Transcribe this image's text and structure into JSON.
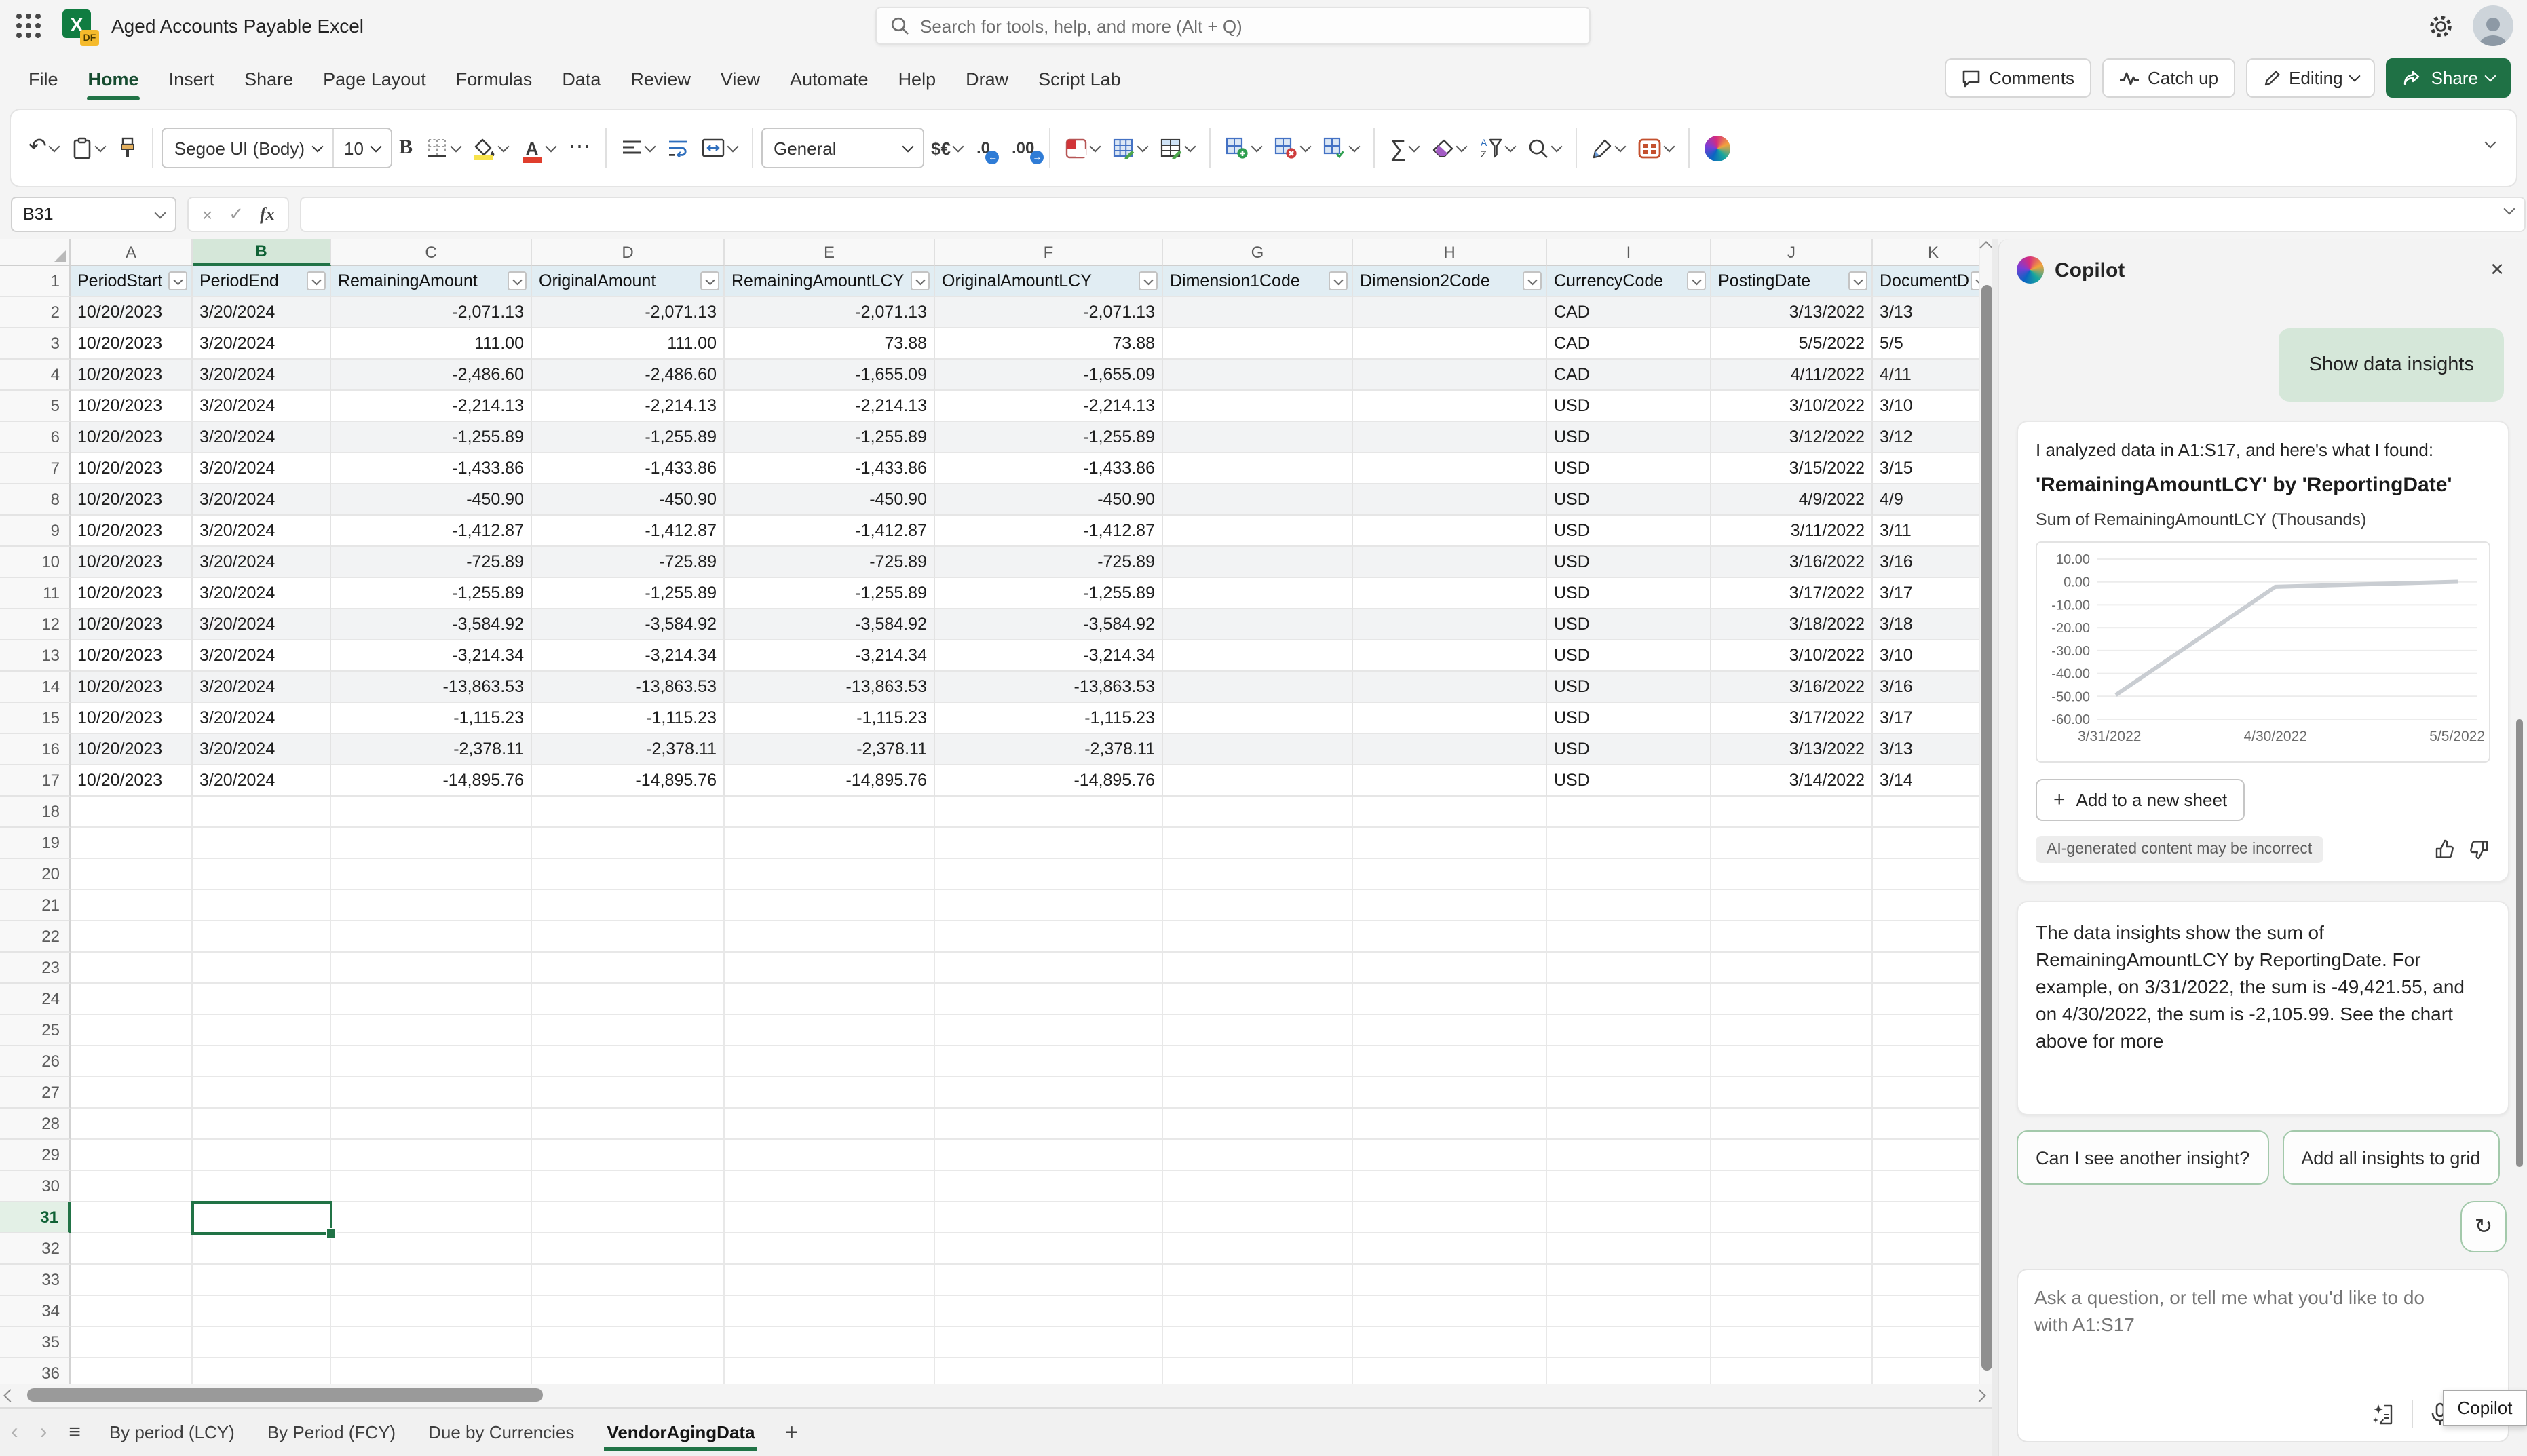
{
  "colors": {
    "accent_green": "#217346",
    "share_button": "#1f7145",
    "table_header_fill": "#e1edf3",
    "band_fill": "#f2f3f4",
    "bubble_fill": "#d5e7d9",
    "chip_border": "#a3c9ab",
    "chart_line": "#c9cdd2"
  },
  "titlebar": {
    "app_title": "Aged Accounts Payable Excel",
    "file_badge": "DF",
    "app_letter": "X",
    "search_placeholder": "Search for tools, help, and more (Alt + Q)"
  },
  "menu": {
    "tabs": [
      "File",
      "Home",
      "Insert",
      "Share",
      "Page Layout",
      "Formulas",
      "Data",
      "Review",
      "View",
      "Automate",
      "Help",
      "Draw",
      "Script Lab"
    ],
    "active_tab": "Home",
    "comments_label": "Comments",
    "catch_up_label": "Catch up",
    "editing_label": "Editing",
    "share_label": "Share"
  },
  "ribbon": {
    "font_name": "Segoe UI (Body)",
    "font_size": "10",
    "number_format": "General"
  },
  "icons": {
    "undo": "↶",
    "more": "⋯",
    "bold": "B",
    "font_color": "A",
    "currency": "$€",
    "dec_decimal": ".0",
    "inc_decimal": ".00",
    "dec_badge": "←",
    "inc_badge": "→",
    "autosum": "∑",
    "cancel": "×",
    "confirm": "✓",
    "fx": "fx",
    "close": "×",
    "plus": "+",
    "hamburger": "≡",
    "nav_left": "‹",
    "nav_right": "›",
    "refresh": "↻"
  },
  "formula_bar": {
    "name_box": "B31",
    "formula_value": ""
  },
  "grid": {
    "selected_cell": "B31",
    "selected_column": "B",
    "selected_row": 31,
    "columns": [
      {
        "letter": "A",
        "label": "PeriodStart",
        "width": 90,
        "align": "left"
      },
      {
        "letter": "B",
        "label": "PeriodEnd",
        "width": 102,
        "align": "left"
      },
      {
        "letter": "C",
        "label": "RemainingAmount",
        "width": 148,
        "align": "right"
      },
      {
        "letter": "D",
        "label": "OriginalAmount",
        "width": 142,
        "align": "right"
      },
      {
        "letter": "E",
        "label": "RemainingAmountLCY",
        "width": 155,
        "align": "right"
      },
      {
        "letter": "F",
        "label": "OriginalAmountLCY",
        "width": 168,
        "align": "right"
      },
      {
        "letter": "G",
        "label": "Dimension1Code",
        "width": 140,
        "align": "left"
      },
      {
        "letter": "H",
        "label": "Dimension2Code",
        "width": 143,
        "align": "left"
      },
      {
        "letter": "I",
        "label": "CurrencyCode",
        "width": 121,
        "align": "left"
      },
      {
        "letter": "J",
        "label": "PostingDate",
        "width": 119,
        "align": "right"
      },
      {
        "letter": "K",
        "label": "DocumentD",
        "width": 90,
        "align": "left"
      }
    ],
    "rows": [
      {
        "n": 2,
        "cells": [
          "10/20/2023",
          "3/20/2024",
          "-2,071.13",
          "-2,071.13",
          "-2,071.13",
          "-2,071.13",
          "",
          "",
          "CAD",
          "3/13/2022",
          "3/13"
        ]
      },
      {
        "n": 3,
        "cells": [
          "10/20/2023",
          "3/20/2024",
          "111.00",
          "111.00",
          "73.88",
          "73.88",
          "",
          "",
          "CAD",
          "5/5/2022",
          "5/5"
        ]
      },
      {
        "n": 4,
        "cells": [
          "10/20/2023",
          "3/20/2024",
          "-2,486.60",
          "-2,486.60",
          "-1,655.09",
          "-1,655.09",
          "",
          "",
          "CAD",
          "4/11/2022",
          "4/11"
        ]
      },
      {
        "n": 5,
        "cells": [
          "10/20/2023",
          "3/20/2024",
          "-2,214.13",
          "-2,214.13",
          "-2,214.13",
          "-2,214.13",
          "",
          "",
          "USD",
          "3/10/2022",
          "3/10"
        ]
      },
      {
        "n": 6,
        "cells": [
          "10/20/2023",
          "3/20/2024",
          "-1,255.89",
          "-1,255.89",
          "-1,255.89",
          "-1,255.89",
          "",
          "",
          "USD",
          "3/12/2022",
          "3/12"
        ]
      },
      {
        "n": 7,
        "cells": [
          "10/20/2023",
          "3/20/2024",
          "-1,433.86",
          "-1,433.86",
          "-1,433.86",
          "-1,433.86",
          "",
          "",
          "USD",
          "3/15/2022",
          "3/15"
        ]
      },
      {
        "n": 8,
        "cells": [
          "10/20/2023",
          "3/20/2024",
          "-450.90",
          "-450.90",
          "-450.90",
          "-450.90",
          "",
          "",
          "USD",
          "4/9/2022",
          "4/9"
        ]
      },
      {
        "n": 9,
        "cells": [
          "10/20/2023",
          "3/20/2024",
          "-1,412.87",
          "-1,412.87",
          "-1,412.87",
          "-1,412.87",
          "",
          "",
          "USD",
          "3/11/2022",
          "3/11"
        ]
      },
      {
        "n": 10,
        "cells": [
          "10/20/2023",
          "3/20/2024",
          "-725.89",
          "-725.89",
          "-725.89",
          "-725.89",
          "",
          "",
          "USD",
          "3/16/2022",
          "3/16"
        ]
      },
      {
        "n": 11,
        "cells": [
          "10/20/2023",
          "3/20/2024",
          "-1,255.89",
          "-1,255.89",
          "-1,255.89",
          "-1,255.89",
          "",
          "",
          "USD",
          "3/17/2022",
          "3/17"
        ]
      },
      {
        "n": 12,
        "cells": [
          "10/20/2023",
          "3/20/2024",
          "-3,584.92",
          "-3,584.92",
          "-3,584.92",
          "-3,584.92",
          "",
          "",
          "USD",
          "3/18/2022",
          "3/18"
        ]
      },
      {
        "n": 13,
        "cells": [
          "10/20/2023",
          "3/20/2024",
          "-3,214.34",
          "-3,214.34",
          "-3,214.34",
          "-3,214.34",
          "",
          "",
          "USD",
          "3/10/2022",
          "3/10"
        ]
      },
      {
        "n": 14,
        "cells": [
          "10/20/2023",
          "3/20/2024",
          "-13,863.53",
          "-13,863.53",
          "-13,863.53",
          "-13,863.53",
          "",
          "",
          "USD",
          "3/16/2022",
          "3/16"
        ]
      },
      {
        "n": 15,
        "cells": [
          "10/20/2023",
          "3/20/2024",
          "-1,115.23",
          "-1,115.23",
          "-1,115.23",
          "-1,115.23",
          "",
          "",
          "USD",
          "3/17/2022",
          "3/17"
        ]
      },
      {
        "n": 16,
        "cells": [
          "10/20/2023",
          "3/20/2024",
          "-2,378.11",
          "-2,378.11",
          "-2,378.11",
          "-2,378.11",
          "",
          "",
          "USD",
          "3/13/2022",
          "3/13"
        ]
      },
      {
        "n": 17,
        "cells": [
          "10/20/2023",
          "3/20/2024",
          "-14,895.76",
          "-14,895.76",
          "-14,895.76",
          "-14,895.76",
          "",
          "",
          "USD",
          "3/14/2022",
          "3/14"
        ]
      }
    ],
    "empty_rows": {
      "from": 18,
      "to": 36
    }
  },
  "sheet_tabs": {
    "tabs": [
      "By period (LCY)",
      "By Period (FCY)",
      "Due by Currencies",
      "VendorAgingData"
    ],
    "active": "VendorAgingData"
  },
  "copilot": {
    "title": "Copilot",
    "user_message": "Show data insights",
    "insight_intro": "I analyzed data in A1:S17, and here's what I found:",
    "insight_title": "'RemainingAmountLCY' by 'ReportingDate'",
    "insight_subtitle": "Sum of RemainingAmountLCY (Thousands)",
    "add_button_label": "Add to a new sheet",
    "disclaimer": "AI-generated content may be incorrect",
    "explanation": "The data insights show the sum of RemainingAmountLCY by ReportingDate. For example, on 3/31/2022, the sum is -49,421.55, and on 4/30/2022, the sum is -2,105.99. See the chart above for more",
    "chips": [
      "Can I see another insight?",
      "Add all insights to grid"
    ],
    "input_placeholder": "Ask a question, or tell me what you'd like to do with A1:S17",
    "tooltip": "Copilot"
  },
  "chart_data": {
    "type": "line",
    "x": [
      "3/31/2022",
      "4/30/2022",
      "5/5/2022"
    ],
    "values": [
      -49.42,
      -2.11,
      0.07
    ],
    "title": "Sum of RemainingAmountLCY (Thousands)",
    "xlabel": "",
    "ylabel": "",
    "ylim": [
      -60,
      10
    ],
    "yticks": [
      10,
      0,
      -10,
      -20,
      -30,
      -40,
      -50,
      -60
    ],
    "grid": true,
    "legend": false,
    "line_color": "#c9cdd2"
  }
}
